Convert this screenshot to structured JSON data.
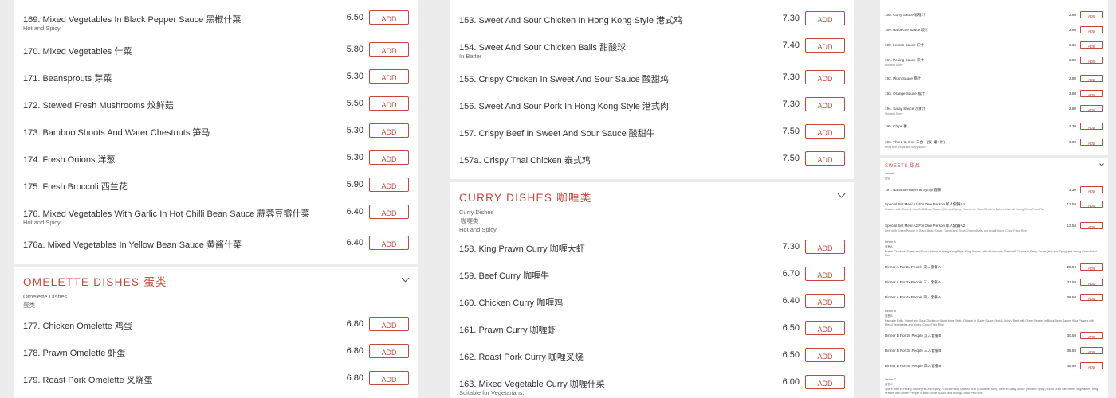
{
  "add_label": "ADD",
  "accent_color": "#c4483c",
  "col1": {
    "items": [
      {
        "name": "169. Mixed Vegetables In Black Pepper Sauce 黑椒什菜",
        "sub": "Hot and Spicy",
        "price": "6.50"
      },
      {
        "name": "170. Mixed Vegetables 什菜",
        "sub": "",
        "price": "5.80"
      },
      {
        "name": "171. Beansprouts 芽菜",
        "sub": "",
        "price": "5.30"
      },
      {
        "name": "172. Stewed Fresh Mushrooms 炆鲜菇",
        "sub": "",
        "price": "5.50"
      },
      {
        "name": "173. Bamboo Shoots And Water Chestnuts 笋马",
        "sub": "",
        "price": "5.30"
      },
      {
        "name": "174. Fresh Onions 洋葱",
        "sub": "",
        "price": "5.30"
      },
      {
        "name": "175. Fresh Broccoli 西兰花",
        "sub": "",
        "price": "5.90"
      },
      {
        "name": "176. Mixed Vegetables With Garlic In Hot Chilli Bean Sauce 蒜蓉豆瓣什菜",
        "sub": "Hot and Spicy",
        "price": "6.40"
      },
      {
        "name": "176a. Mixed Vegetables In Yellow Bean Sauce 黄酱什菜",
        "sub": "",
        "price": "6.40"
      }
    ],
    "omelette": {
      "title": "OMELETTE DISHES 蛋类",
      "sub_en": "Omelette Dishes",
      "sub_cn": "蛋类",
      "items": [
        {
          "name": "177. Chicken Omelette 鸡蛋",
          "price": "6.80"
        },
        {
          "name": "178. Prawn Omelette 虾蛋",
          "price": "6.80"
        },
        {
          "name": "179. Roast Pork Omelette 叉烧蛋",
          "price": "6.80"
        }
      ]
    }
  },
  "col2": {
    "items": [
      {
        "name": "153. Sweet And Sour Chicken In Hong Kong Style 港式鸡",
        "sub": "",
        "price": "7.30"
      },
      {
        "name": "154. Sweet And Sour Chicken Balls 甜酸球",
        "sub": "In Batter",
        "price": "7.40"
      },
      {
        "name": "155. Crispy Chicken In Sweet And Sour Sauce 酸甜鸡",
        "sub": "",
        "price": "7.30"
      },
      {
        "name": "156. Sweet And Sour Pork In Hong Kong Style 港式肉",
        "sub": "",
        "price": "7.30"
      },
      {
        "name": "157. Crispy Beef In Sweet And Sour Sauce 酸甜牛",
        "sub": "",
        "price": "7.50"
      },
      {
        "name": "157a. Crispy Thai Chicken 泰式鸡",
        "sub": "",
        "price": "7.50"
      }
    ],
    "curry": {
      "title": "CURRY DISHES 咖喱类",
      "sub_en": "Curry Dishes",
      "sub_cn": "咖喱类",
      "sub_hot": "Hot and Spicy",
      "items": [
        {
          "name": "158. King Prawn Curry 咖喱大虾",
          "sub": "",
          "price": "7.30"
        },
        {
          "name": "159. Beef Curry 咖喱牛",
          "sub": "",
          "price": "6.70"
        },
        {
          "name": "160. Chicken Curry 咖喱鸡",
          "sub": "",
          "price": "6.40"
        },
        {
          "name": "161. Prawn Curry 咖喱虾",
          "sub": "",
          "price": "6.50"
        },
        {
          "name": "162. Roast Pork Curry 咖喱叉烧",
          "sub": "",
          "price": "6.50"
        },
        {
          "name": "163. Mixed Vegetable Curry 咖喱什菜",
          "sub": "Suitable for Vegetarians.",
          "price": "6.00"
        }
      ]
    }
  },
  "col3": {
    "items": [
      {
        "name": "188. Curry Sauce 咖喱汁",
        "sub": "",
        "price": "2.60"
      },
      {
        "name": "189. Barbecue Sauce 烧汁",
        "sub": "",
        "price": "2.60"
      },
      {
        "name": "190. Lemon Sauce 柠汁",
        "sub": "",
        "price": "2.60"
      },
      {
        "name": "191. Peking Sauce 京汁",
        "sub": "Hot and Spicy",
        "price": "2.80"
      },
      {
        "name": "192. Plum Sauce 梅汁",
        "sub": "",
        "price": "2.80"
      },
      {
        "name": "193. Orange Sauce 橙汁",
        "sub": "",
        "price": "2.60"
      },
      {
        "name": "194. Satay Sauce 沙爹汁",
        "sub": "Hot and Spicy",
        "price": "2.80"
      },
      {
        "name": "195. Chips 薯",
        "sub": "",
        "price": "3.30"
      },
      {
        "name": "196. Three-In-One 三合一(饭+薯+汁)",
        "sub": "Fried rice, chips and curry sauce",
        "price": "6.00"
      }
    ],
    "sweets": {
      "title": "SWEETS 甜品",
      "sub_en": "Sweets",
      "sub_cn": "甜品",
      "items": [
        {
          "name": "197. Banana Fritters In Syrup 香蕉",
          "sub": "",
          "price": "3.30"
        },
        {
          "name": "Special Set Meal A1 For One Person 单人套餐A1",
          "sub": "Chicken with Garlic in Hot Chilli Bean Sauce (Hot and Spicy), Sweet and Sour Chicken Balls and small Young Chow Fried Rice",
          "price": "13.50"
        },
        {
          "name": "Special Set Meal A2 For One Person 单人套餐A2",
          "sub": "Beef with Green Pepper in Black Bean Sauce, Sweet and Sour Chicken Balls and small Young Chow Fried Rice",
          "price": "13.50"
        },
        {
          "name": "Dinner A For 2x People 双人套餐A",
          "sub": "",
          "price": "25.50"
        },
        {
          "name": "Dinner A For 3x People 三人套餐A",
          "sub": "",
          "price": "31.50"
        },
        {
          "name": "Dinner A For 4x People 四人套餐A",
          "sub": "",
          "price": "39.50"
        },
        {
          "name": "Dinner B For 2x People 双人套餐B",
          "sub": "",
          "price": "30.50"
        },
        {
          "name": "Dinner B For 3x People 三人套餐B",
          "sub": "",
          "price": "38.50"
        },
        {
          "name": "Dinner B For 4x People 四人套餐B",
          "sub": "",
          "price": "46.50"
        }
      ],
      "dinner_a_header": "Dinner A",
      "dinner_a_cn": "套餐A",
      "dinner_a_desc": "Prawn Crackers, Sweet and Sour Chicken in Hong Kong Style, King Prawns with Mushrooms, Beef with Onions in Satay Sauce (Hot and Spicy) and Young Chow Fried Rice",
      "dinner_b_header": "Dinner B",
      "dinner_b_cn": "套餐B",
      "dinner_b_desc": "Pancake Rolls, Sweet and Sour Chicken in Hong Kong Style, Chicken in Satay Sauce (Hot & Spicy), Beef with Green Pepper in Black Bean Sauce, King Prawns with Mixed Vegetables and Young Chow Fried Rice",
      "dinner_c_header": "Dinner C",
      "dinner_c_cn": "套餐C",
      "dinner_c_desc": "Spare Ribs in Peking Sauce (Hot and Spicy), Chicken with Cashew Nuts (Contains Nuts), Beef in Satay Sauce (Hot and Spicy) Roast Duck with Mixed Vegetables, King Prawns with Green Pepper in Black Bean Sauce and Young Chow Fried Rice"
    }
  }
}
